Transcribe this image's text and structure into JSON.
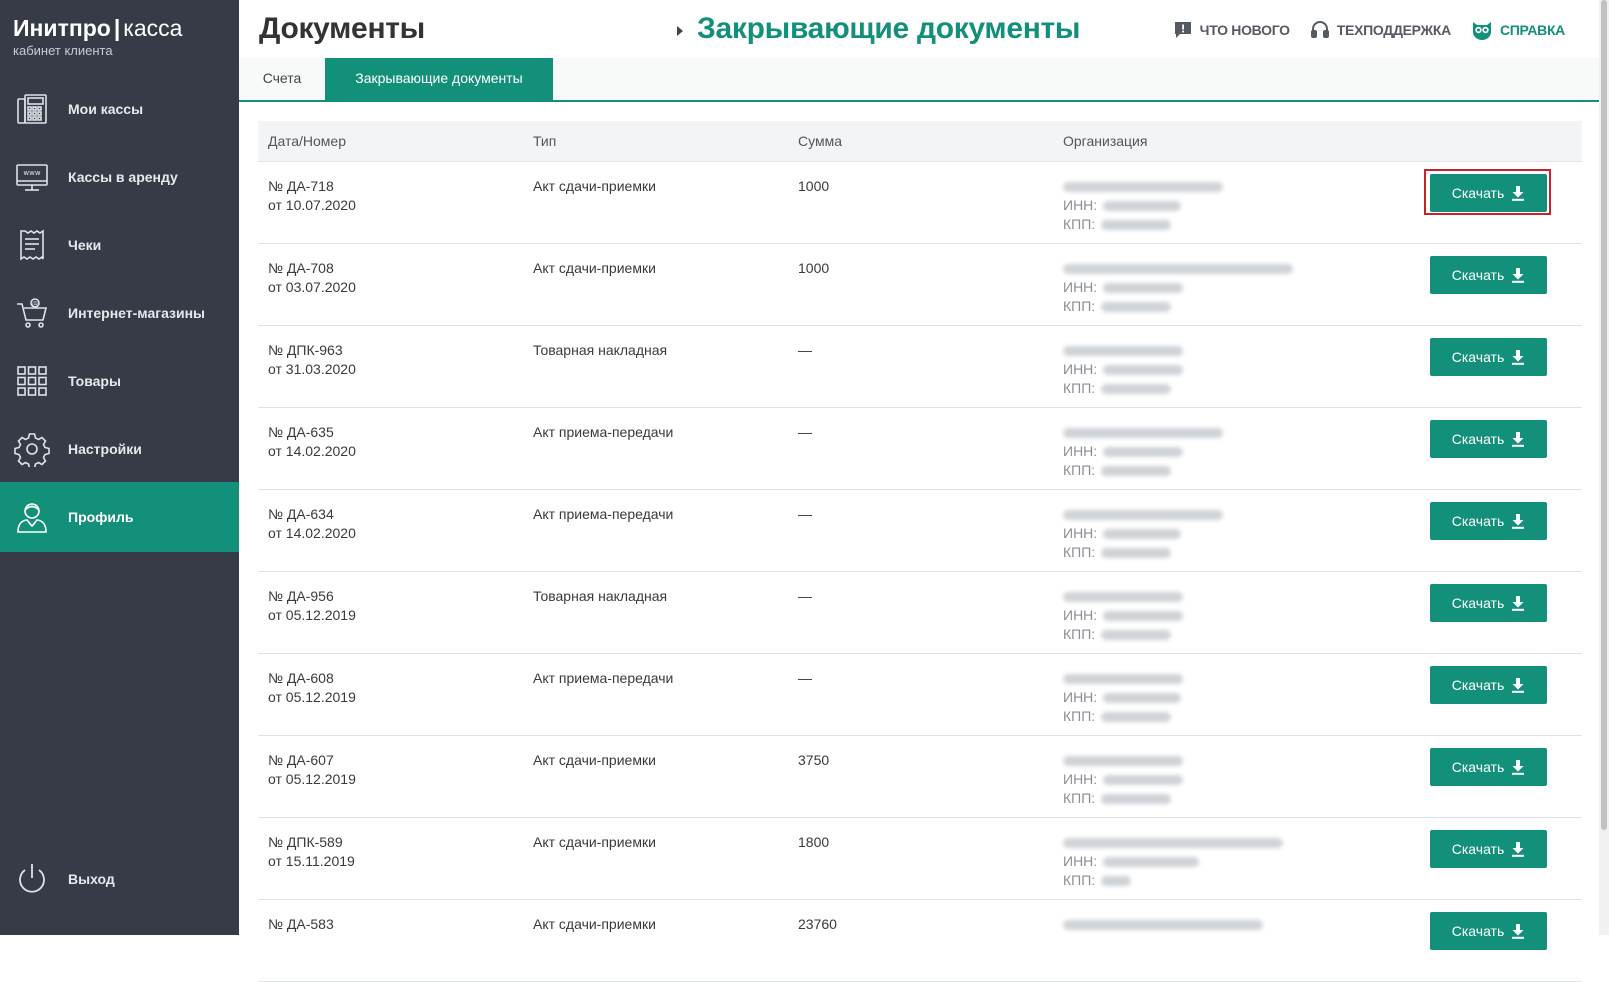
{
  "sidebar": {
    "logo_brand": "Инитпро",
    "logo_sep": "|",
    "logo_product": "касса",
    "logo_sub": "кабинет клиента",
    "items": [
      {
        "label": "Мои кассы",
        "icon": "cash-register-icon"
      },
      {
        "label": "Кассы в аренду",
        "icon": "web-monitor-icon"
      },
      {
        "label": "Чеки",
        "icon": "receipt-icon"
      },
      {
        "label": "Интернет-магазины",
        "icon": "shopping-cart-icon"
      },
      {
        "label": "Товары",
        "icon": "grid-icon"
      },
      {
        "label": "Настройки",
        "icon": "gear-icon"
      },
      {
        "label": "Профиль",
        "icon": "user-icon",
        "active": true
      }
    ],
    "logout_label": "Выход",
    "logout_icon": "power-icon"
  },
  "header": {
    "title": "Документы",
    "current": "Закрывающие документы",
    "links": [
      {
        "label": "ЧТО НОВОГО",
        "icon": "chat-alert-icon"
      },
      {
        "label": "ТЕХПОДДЕРЖКА",
        "icon": "headset-icon"
      },
      {
        "label": "СПРАВКА",
        "icon": "owl-icon"
      }
    ]
  },
  "tabs": [
    {
      "label": "Счета"
    },
    {
      "label": "Закрывающие документы",
      "active": true
    }
  ],
  "table": {
    "columns": [
      "Дата/Номер",
      "Тип",
      "Сумма",
      "Организация"
    ],
    "inn_label": "ИНН:",
    "kpp_label": "КПП:",
    "download_label": "Скачать",
    "rows": [
      {
        "number": "№ ДА-718",
        "date": "от 10.07.2020",
        "type": "Акт сдачи-приемки",
        "sum": "1000"
      },
      {
        "number": "№ ДА-708",
        "date": "от 03.07.2020",
        "type": "Акт сдачи-приемки",
        "sum": "1000"
      },
      {
        "number": "№ ДПК-963",
        "date": "от 31.03.2020",
        "type": "Товарная накладная",
        "sum": "—"
      },
      {
        "number": "№ ДА-635",
        "date": "от 14.02.2020",
        "type": "Акт приема-передачи",
        "sum": "—"
      },
      {
        "number": "№ ДА-634",
        "date": "от 14.02.2020",
        "type": "Акт приема-передачи",
        "sum": "—"
      },
      {
        "number": "№ ДА-956",
        "date": "от 05.12.2019",
        "type": "Товарная накладная",
        "sum": "—"
      },
      {
        "number": "№ ДА-608",
        "date": "от 05.12.2019",
        "type": "Акт приема-передачи",
        "sum": "—"
      },
      {
        "number": "№ ДА-607",
        "date": "от 05.12.2019",
        "type": "Акт сдачи-приемки",
        "sum": "3750"
      },
      {
        "number": "№ ДПК-589",
        "date": "от 15.11.2019",
        "type": "Акт сдачи-приемки",
        "sum": "1800"
      },
      {
        "number": "№ ДА-583",
        "date": "",
        "type": "Акт сдачи-приемки",
        "sum": "23760"
      }
    ]
  },
  "colors": {
    "accent": "#13907a",
    "sidebar_bg": "#363b47",
    "highlight": "#c8222a"
  }
}
